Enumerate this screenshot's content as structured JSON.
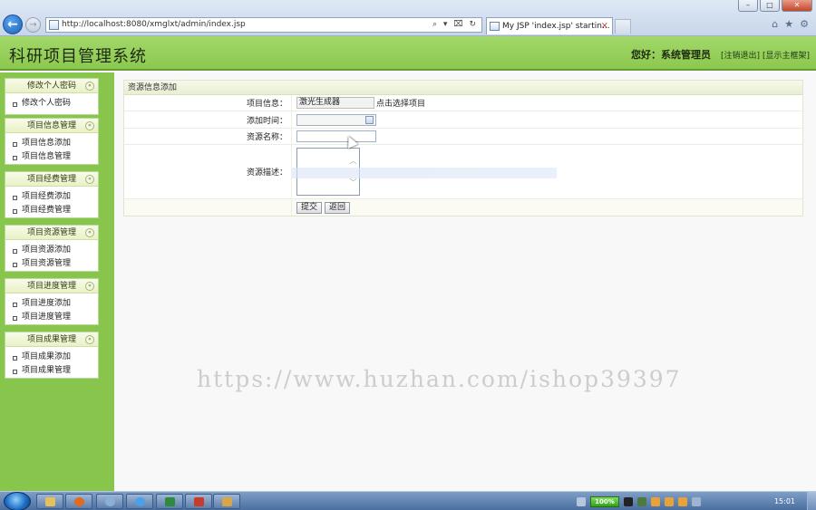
{
  "browser": {
    "address_url": "http://localhost:8080/xmglxt/admin/index.jsp",
    "tab_title": "My JSP 'index.jsp' startin...",
    "tab_close": "×",
    "back_glyph": "←",
    "forward_glyph": "→",
    "addr_tools": "⌕ ▾ ⌧ ↻",
    "window_controls": {
      "minimize": "–",
      "maximize": "□",
      "close": "✕"
    },
    "toolbar_icons": [
      "home-icon",
      "star-icon",
      "gear-icon"
    ]
  },
  "header": {
    "title": "科研项目管理系统",
    "greeting": "您好：系统管理员",
    "logout_link": "[注销退出]",
    "home_link": "[显示主框架]"
  },
  "sidebar": {
    "groups": [
      {
        "title": "修改个人密码",
        "items": [
          "修改个人密码"
        ]
      },
      {
        "title": "项目信息管理",
        "items": [
          "项目信息添加",
          "项目信息管理"
        ]
      },
      {
        "title": "项目经费管理",
        "items": [
          "项目经费添加",
          "项目经费管理"
        ]
      },
      {
        "title": "项目资源管理",
        "items": [
          "项目资源添加",
          "项目资源管理"
        ]
      },
      {
        "title": "项目进度管理",
        "items": [
          "项目进度添加",
          "项目进度管理"
        ]
      },
      {
        "title": "项目成果管理",
        "items": [
          "项目成果添加",
          "项目成果管理"
        ]
      }
    ],
    "collapse_glyph": "«"
  },
  "form": {
    "title": "资源信息添加",
    "project_label": "项目信息：",
    "project_value": "激光生成器",
    "project_pick": "点击选择项目",
    "time_label": "添加时间：",
    "time_value": "",
    "name_label": "资源名称：",
    "name_value": "",
    "desc_label": "资源描述：",
    "desc_value": "",
    "submit_label": "提交",
    "back_label": "返回"
  },
  "watermark": "https://www.huzhan.com/ishop39397",
  "taskbar": {
    "battery": "100%",
    "clock": "15:01"
  },
  "colors": {
    "header_green": "#8cc84f",
    "sidebar_green": "#88c54c",
    "taskbar_blue": "#4a6f9f"
  }
}
